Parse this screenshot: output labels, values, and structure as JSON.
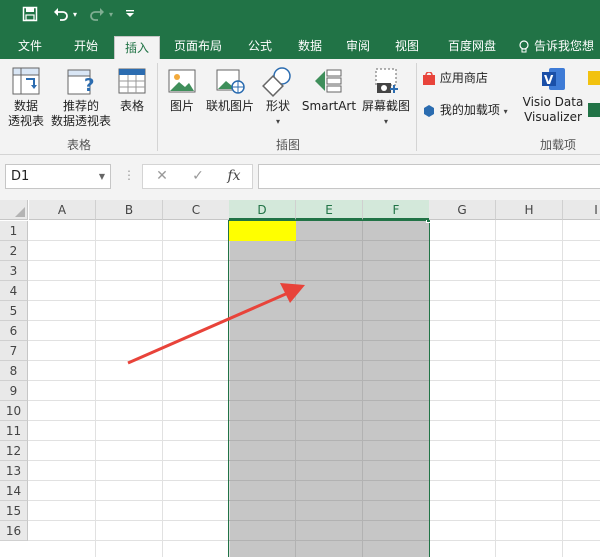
{
  "titlebar": {
    "save_icon": "save-icon",
    "undo_icon": "undo-icon",
    "redo_icon": "redo-icon",
    "customize_icon": "chevron-down-icon"
  },
  "tabs": [
    {
      "label": "文件",
      "active": false
    },
    {
      "label": "开始",
      "active": false
    },
    {
      "label": "插入",
      "active": true
    },
    {
      "label": "页面布局",
      "active": false
    },
    {
      "label": "公式",
      "active": false
    },
    {
      "label": "数据",
      "active": false
    },
    {
      "label": "审阅",
      "active": false
    },
    {
      "label": "视图",
      "active": false
    },
    {
      "label": "百度网盘",
      "active": false
    }
  ],
  "tell_me": "告诉我您想",
  "ribbon": {
    "pivot_table": "数据\n透视表",
    "recommended_pivot": "推荐的\n数据透视表",
    "table": "表格",
    "group_tables": "表格",
    "picture": "图片",
    "online_picture": "联机图片",
    "shapes": "形状",
    "smartart": "SmartArt",
    "screenshot": "屏幕截图",
    "group_illustrations": "插图",
    "app_store": "应用商店",
    "my_addins": "我的加载项",
    "visio": "Visio Data\nVisualizer",
    "group_addins": "加载项"
  },
  "formula_bar": {
    "name_box": "D1",
    "cancel": "✕",
    "enter": "✓",
    "fx": "fx",
    "value": ""
  },
  "columns": [
    "A",
    "B",
    "C",
    "D",
    "E",
    "F",
    "G",
    "H",
    "I"
  ],
  "rows": [
    "1",
    "2",
    "3",
    "4",
    "5",
    "6",
    "7",
    "8",
    "9",
    "10",
    "11",
    "12",
    "13",
    "14",
    "15",
    "16"
  ],
  "selected_columns": [
    "D",
    "E",
    "F"
  ],
  "colors": {
    "accent": "#217346",
    "selection_fill": "#c6c6c6",
    "highlight_cell": "#ffff00",
    "arrow": "#e8433a"
  }
}
